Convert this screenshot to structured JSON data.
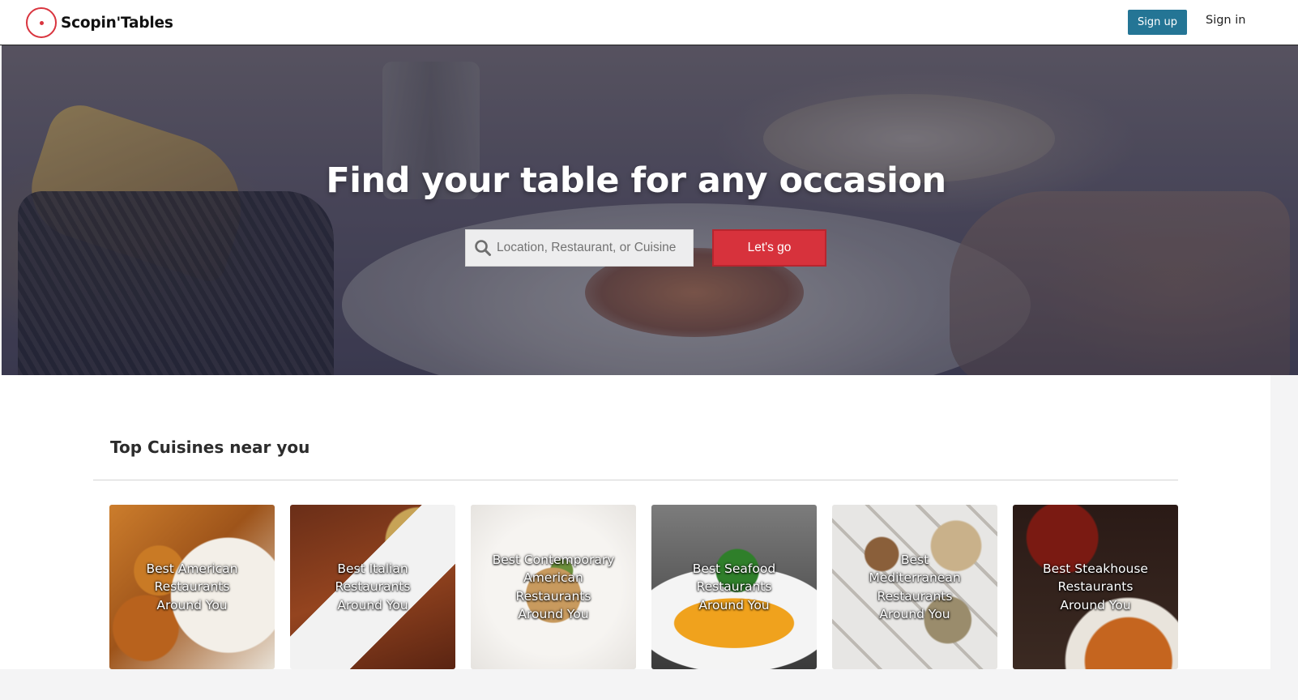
{
  "header": {
    "brand": "Scopin'Tables",
    "signup_label": "Sign up",
    "signin_label": "Sign in",
    "brand_color": "#d9343e",
    "signup_color": "#247595"
  },
  "hero": {
    "title": "Find your table for any occasion",
    "search_placeholder": "Location, Restaurant, or Cuisine",
    "search_value": "",
    "go_label": "Let's go",
    "go_color": "#d7323c"
  },
  "cuisines": {
    "title": "Top Cuisines near you",
    "cards": [
      {
        "label": "Best American Restaurants Around You"
      },
      {
        "label": "Best Italian Restaurants Around You"
      },
      {
        "label": "Best Contemporary American Restaurants Around You"
      },
      {
        "label": "Best Seafood Restaurants Around You"
      },
      {
        "label": "Best Mediterranean Restaurants Around You"
      },
      {
        "label": "Best Steakhouse Restaurants Around You"
      }
    ]
  },
  "icons": {
    "logo": "target-logo-icon",
    "search": "search-icon"
  }
}
